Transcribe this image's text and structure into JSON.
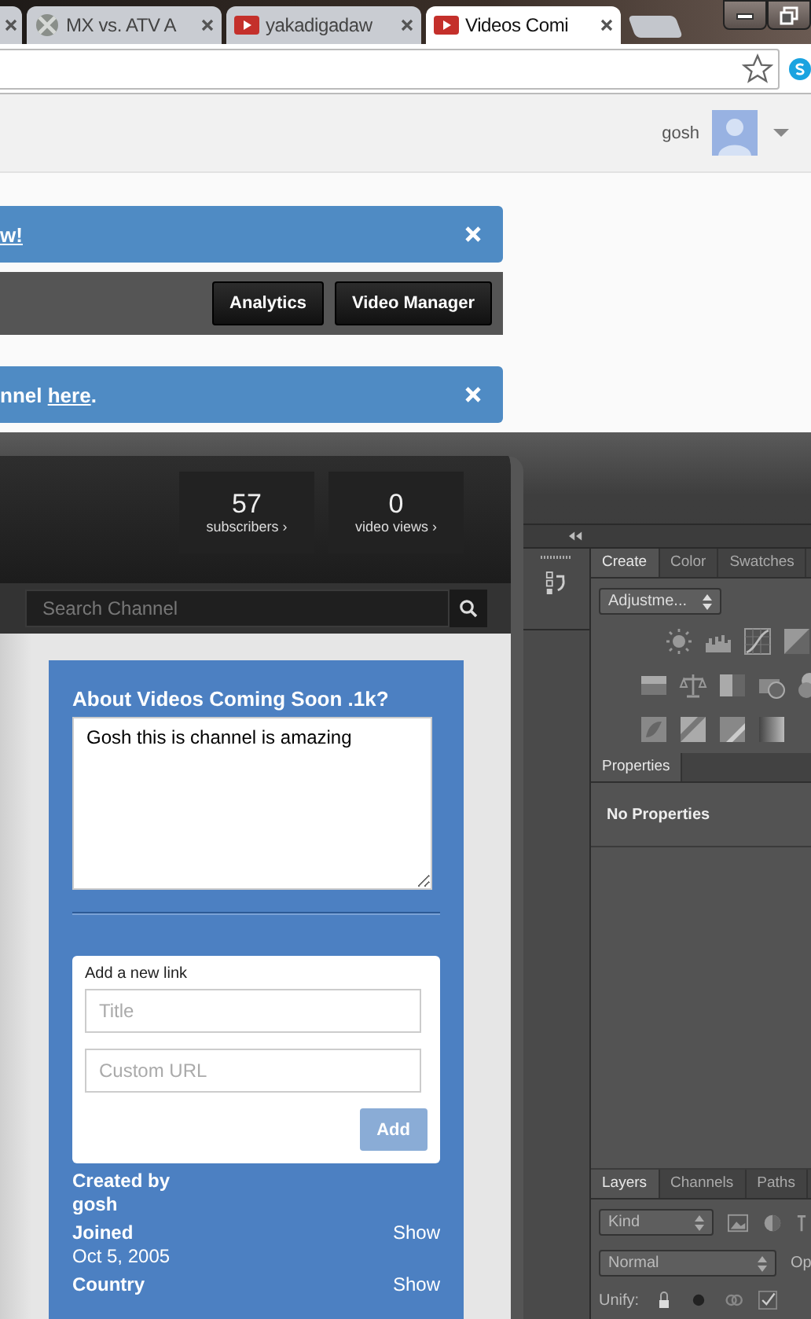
{
  "browser": {
    "tabs": [
      {
        "kind": "partial",
        "selected": false
      },
      {
        "kind": "xbox",
        "title": "MX vs. ATV A",
        "selected": false
      },
      {
        "kind": "youtube",
        "title": "yakadigadaw",
        "selected": false
      },
      {
        "kind": "youtube",
        "title": "Videos Comi",
        "selected": true
      }
    ]
  },
  "header": {
    "username": "gosh"
  },
  "banners": [
    {
      "link": "w!"
    },
    {
      "text": "nnel ",
      "link": "here",
      "text_after": "."
    }
  ],
  "toolbar": {
    "buttons": [
      "Analytics",
      "Video Manager"
    ]
  },
  "channel": {
    "stats": [
      {
        "value": "57",
        "label": "subscribers ›"
      },
      {
        "value": "0",
        "label": "video views ›"
      }
    ],
    "search": {
      "placeholder": "Search Channel"
    },
    "about": {
      "title": "About Videos Coming Soon .1k?",
      "description": "Gosh this is channel is amazing"
    },
    "add_link": {
      "heading": "Add a new link",
      "title_placeholder": "Title",
      "url_placeholder": "Custom URL",
      "button": "Add",
      "disabled": true
    },
    "details": [
      {
        "label": "Created by",
        "value": "gosh"
      },
      {
        "label": "Joined",
        "action": "Show",
        "value": "Oct 5, 2005"
      },
      {
        "label": "Country",
        "action": "Show"
      }
    ]
  },
  "photoshop": {
    "top_tabs": [
      {
        "label": "Create",
        "selected": true
      },
      {
        "label": "Color",
        "selected": false
      },
      {
        "label": "Swatches",
        "selected": false
      }
    ],
    "dropdown": "Adjustme...",
    "properties_tab": "Properties",
    "properties_text": "No Properties",
    "layer_tabs": [
      {
        "label": "Layers",
        "selected": true
      },
      {
        "label": "Channels",
        "selected": false
      },
      {
        "label": "Paths",
        "selected": false
      }
    ],
    "filter": "Kind",
    "blend_mode": "Normal",
    "opacity_label": "Op",
    "lock_label": "Unify:"
  }
}
